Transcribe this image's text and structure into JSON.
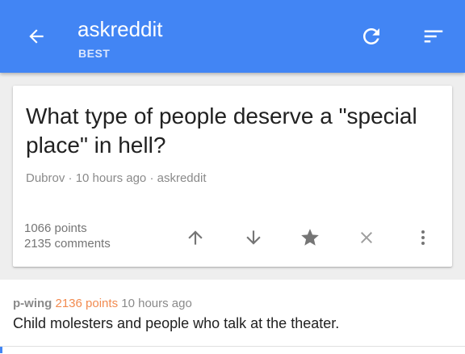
{
  "header": {
    "title": "askreddit",
    "subtitle": "BEST",
    "icons": {
      "back": "arrow-back-icon",
      "refresh": "refresh-icon",
      "sort": "sort-icon"
    },
    "colors": {
      "background": "#4285f4",
      "text": "#ffffff"
    }
  },
  "post": {
    "title": "What type of people deserve a \"special place\" in hell?",
    "author": "Dubrov",
    "separator": "·",
    "time": "10 hours ago",
    "subreddit": "askreddit",
    "points": "1066 points",
    "comments": "2135 comments",
    "actions": [
      "upvote-icon",
      "downvote-icon",
      "star-icon",
      "close-icon",
      "more-vert-icon"
    ]
  },
  "comment": {
    "author": "p-wing",
    "points": "2136 points",
    "time": "10 hours ago",
    "text": "Child molesters and people who talk at the theater.",
    "colors": {
      "points": "#f28b50"
    }
  }
}
